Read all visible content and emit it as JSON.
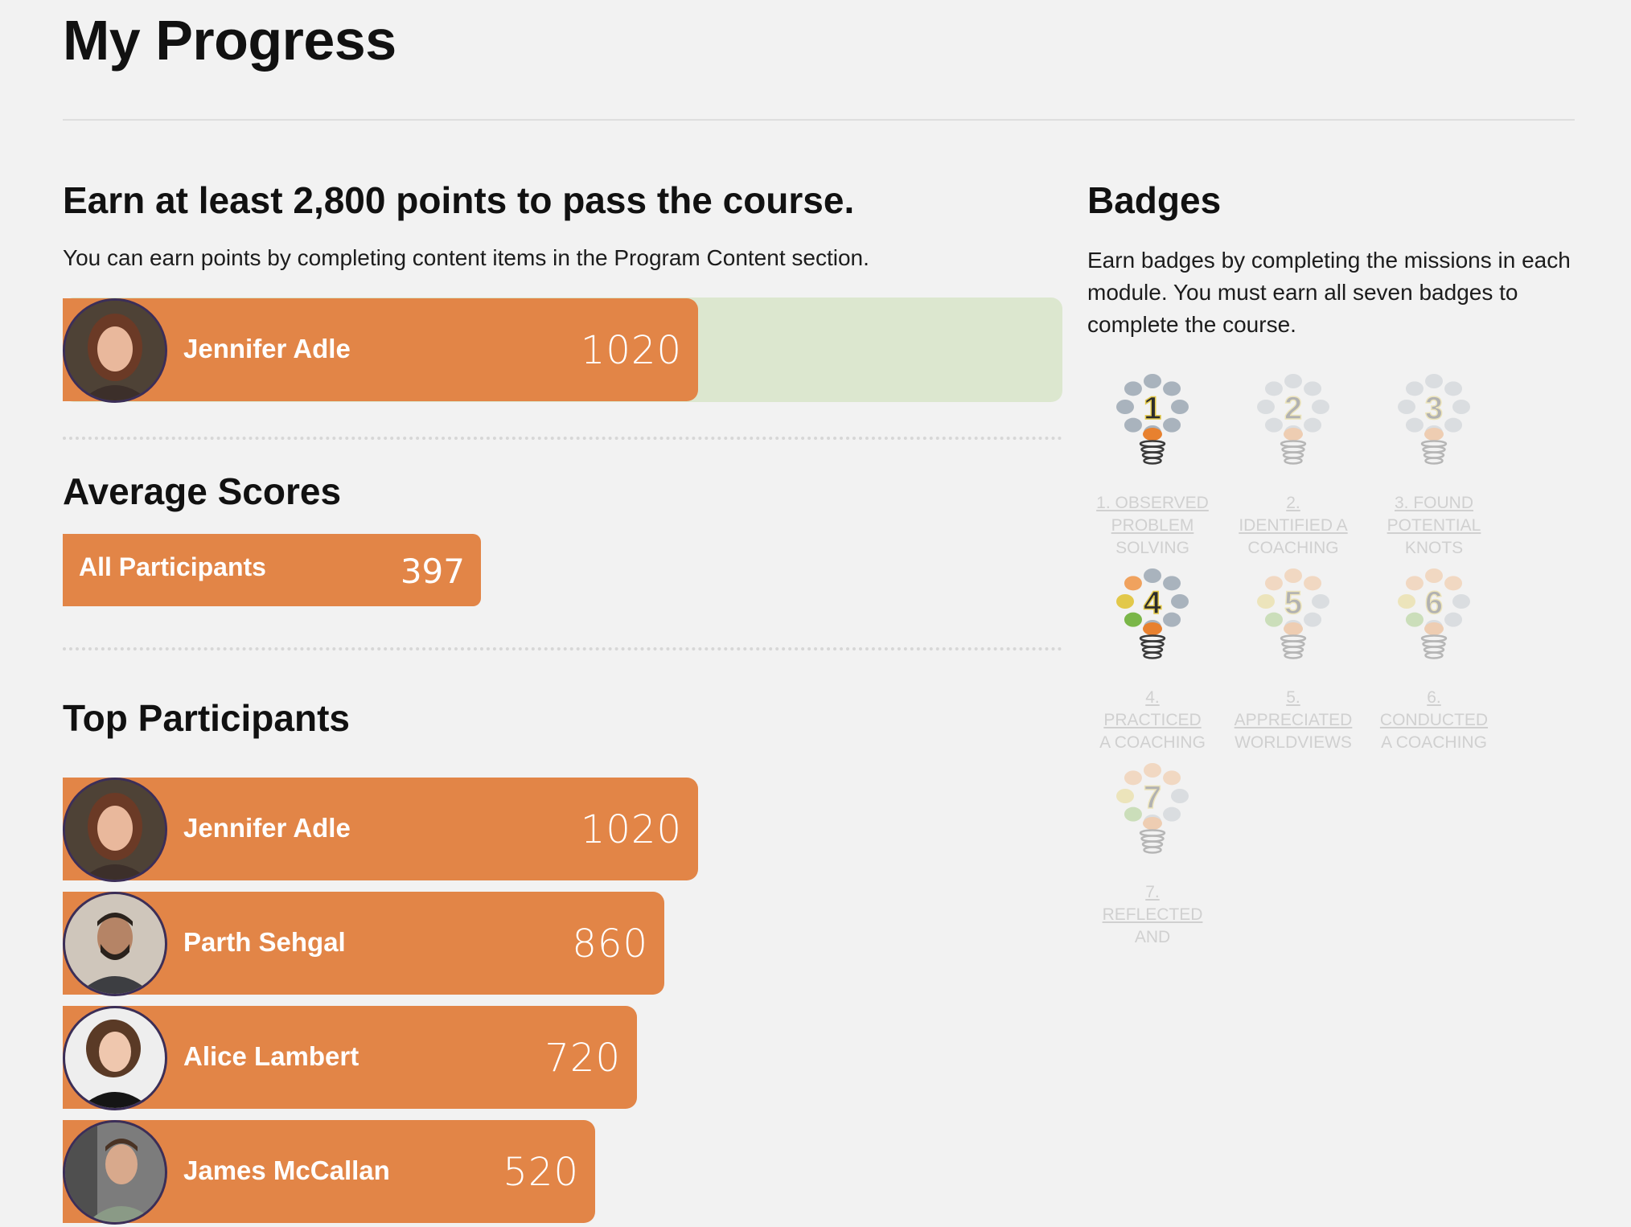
{
  "page": {
    "title": "My Progress"
  },
  "points": {
    "heading": "Earn at least 2,800 points to pass the course.",
    "description": "You can earn points by completing content items in the Program Content section.",
    "goal": 2800,
    "user": {
      "name": "Jennifer Adle",
      "score": "1020"
    }
  },
  "average": {
    "heading": "Average Scores",
    "label": "All Participants",
    "score": "397"
  },
  "top": {
    "heading": "Top Participants",
    "participants": [
      {
        "name": "Jennifer Adle",
        "score": "1020"
      },
      {
        "name": "Parth Sehgal",
        "score": "860"
      },
      {
        "name": "Alice Lambert",
        "score": "720"
      },
      {
        "name": "James McCallan",
        "score": "520"
      }
    ]
  },
  "badges": {
    "heading": "Badges",
    "description_lines": [
      "Earn badges by completing the missions in each",
      "module. You must earn all seven badges to",
      "complete the course."
    ],
    "items": [
      {
        "number": "1",
        "earned": true,
        "caption_link": [
          "1. OBSERVED",
          "PROBLEM"
        ],
        "caption_rest": "SOLVING"
      },
      {
        "number": "2",
        "earned": false,
        "caption_link": [
          "2.",
          "IDENTIFIED A"
        ],
        "caption_rest": "COACHING"
      },
      {
        "number": "3",
        "earned": false,
        "caption_link": [
          "3. FOUND",
          "POTENTIAL"
        ],
        "caption_rest": "KNOTS"
      },
      {
        "number": "4",
        "earned": true,
        "caption_link": [
          "4.",
          "PRACTICED"
        ],
        "caption_rest": "A COACHING"
      },
      {
        "number": "5",
        "earned": false,
        "caption_link": [
          "5.",
          "APPRECIATED"
        ],
        "caption_rest": "WORLDVIEWS"
      },
      {
        "number": "6",
        "earned": false,
        "caption_link": [
          "6.",
          "CONDUCTED"
        ],
        "caption_rest": "A COACHING"
      },
      {
        "number": "7",
        "earned": false,
        "caption_link": [
          "7.",
          "REFLECTED"
        ],
        "caption_rest": "AND"
      }
    ]
  },
  "colors": {
    "bar": "#e28547",
    "track": "#dce7cf",
    "background": "#f2f2f2"
  }
}
